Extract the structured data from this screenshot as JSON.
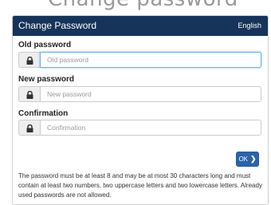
{
  "page": {
    "heading_cut": "Change password"
  },
  "header": {
    "title": "Change Password",
    "language": "English"
  },
  "form": {
    "old_password": {
      "label": "Old password",
      "placeholder": "Old password"
    },
    "new_password": {
      "label": "New password",
      "placeholder": "New password"
    },
    "confirmation": {
      "label": "Confirmation",
      "placeholder": "Confirmation"
    },
    "submit_label": "OK",
    "submit_icon": "chevron-right-icon"
  },
  "help_text": "The password must be at least 8 and may be at most 30 characters long and must contain at least two numbers, two uppercase letters and two lowercase letters. Already used passwords are not allowed.",
  "colors": {
    "header_bg": "#16345a",
    "button_bg": "#2a64a8",
    "focus_border": "#66afe9"
  }
}
